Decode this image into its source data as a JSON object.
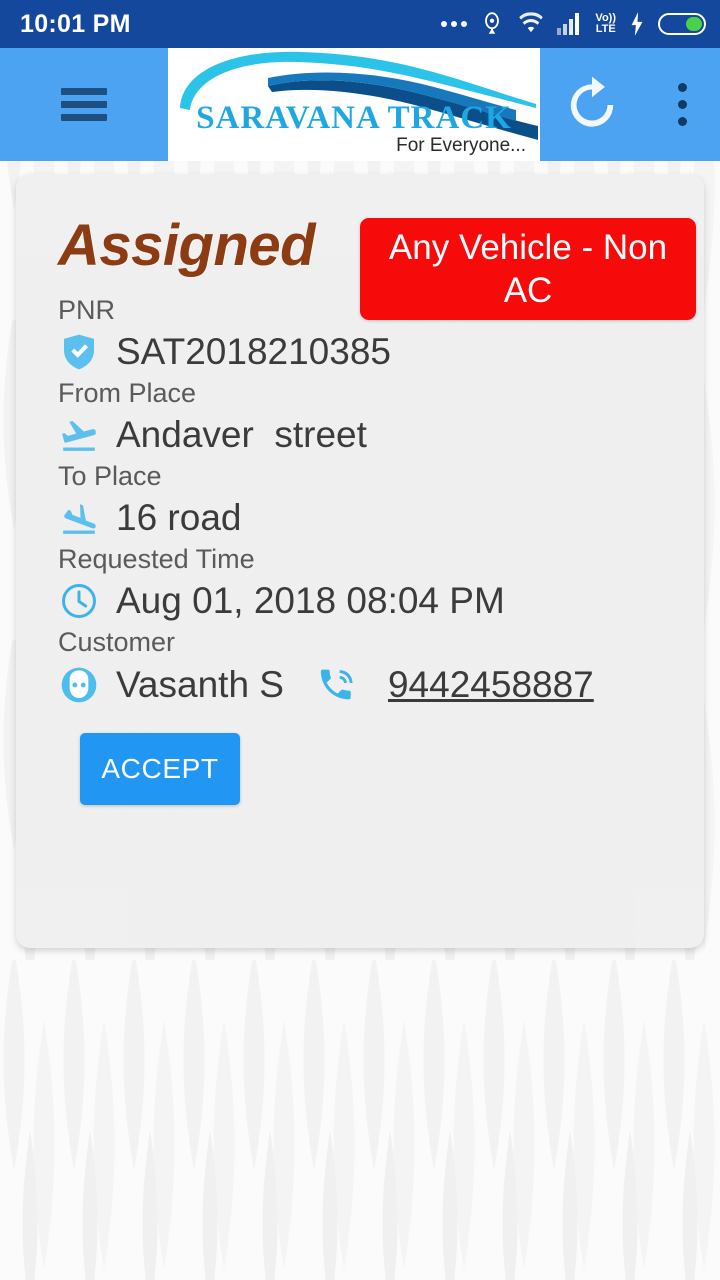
{
  "status_bar": {
    "clock": "10:01 PM",
    "icons": [
      "more-dots-icon",
      "hotspot-icon",
      "wifi-icon",
      "signal-icon",
      "volte-icon",
      "charging-bolt-icon",
      "battery-icon"
    ],
    "volte_top": "Vo))",
    "volte_bottom": "LTE",
    "background_color": "#14489c",
    "battery_color": "#49d149"
  },
  "app_bar": {
    "menu_label": "menu",
    "logo_title": "SARAVANA TRACK",
    "logo_tagline": "For Everyone...",
    "refresh_label": "refresh",
    "overflow_label": "more options",
    "background_color": "#4ba3f2",
    "logo_title_color": "#1ea7e1"
  },
  "card": {
    "status_title": "Assigned",
    "status_title_color": "#8c3b12",
    "vehicle_badge": "Any Vehicle - Non AC",
    "vehicle_badge_color": "#f70a0a",
    "fields": [
      {
        "label": "PNR",
        "value": "SAT2018210385",
        "icon": "verified-shield-icon"
      },
      {
        "label": "From Place",
        "value": "Andaver  street",
        "icon": "flight-takeoff-icon"
      },
      {
        "label": "To Place",
        "value": "16 road",
        "icon": "flight-land-icon"
      },
      {
        "label": "Requested Time",
        "value": "Aug 01, 2018 08:04 PM",
        "icon": "clock-icon"
      }
    ],
    "customer": {
      "label": "Customer",
      "name": "Vasanth S",
      "name_icon": "face-icon",
      "phone": "9442458887",
      "phone_icon": "phone-in-talk-icon"
    },
    "accept_label": "ACCEPT",
    "accept_color": "#2196f3",
    "accent_icon_color": "#5cc0ef"
  }
}
